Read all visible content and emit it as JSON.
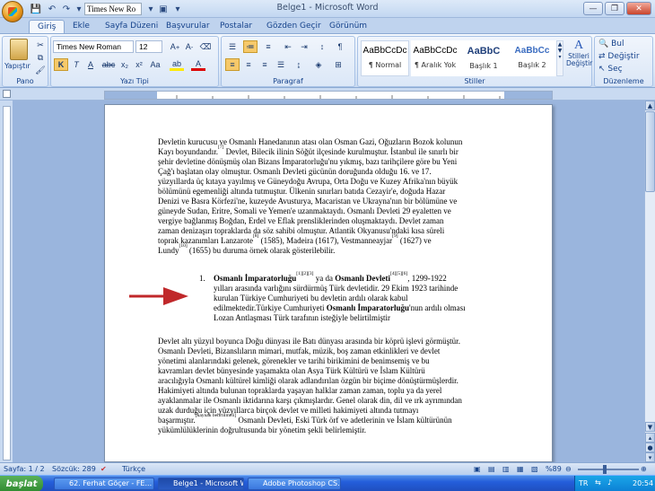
{
  "window": {
    "title": "Belge1 - Microsoft Word"
  },
  "qat": {
    "font_name": "Times New Ro"
  },
  "tabs": [
    "Giriş",
    "Ekle",
    "Sayfa Düzeni",
    "Başvurular",
    "Postalar",
    "Gözden Geçir",
    "Görünüm"
  ],
  "ribbon": {
    "paste_label": "Yapıştır",
    "font_name": "Times New Roman",
    "font_size": "12",
    "groups": {
      "clipboard": "Pano",
      "font": "Yazı Tipi",
      "paragraph": "Paragraf",
      "styles": "Stiller",
      "editing": "Düzenleme"
    },
    "styles": [
      {
        "preview": "AaBbCcDc",
        "name": "¶ Normal"
      },
      {
        "preview": "AaBbCcDc",
        "name": "¶ Aralık Yok"
      },
      {
        "preview": "AaBbC",
        "name": "Başlık 1"
      },
      {
        "preview": "AaBbCc",
        "name": "Başlık 2"
      }
    ],
    "change_styles": "Stilleri Değiştir",
    "find": "Bul",
    "replace": "Değiştir",
    "select": "Seç"
  },
  "document": {
    "para1": [
      "Devletin kurucusu ve Osmanlı Hanedanının atası olan Osman Gazi, Oğuzların Bozok kolunun",
      "Kayı boyundandır.",
      " Devlet, Bilecik ilinin Söğüt ilçesinde kurulmuştur. İstanbul ile sınırlı bir",
      "şehir devletine dönüşmüş olan Bizans İmparatorluğu'nu yıkmış, bazı tarihçilere göre bu Yeni",
      "Çağ'ı başlatan olay olmuştur. Osmanlı Devleti gücünün doruğunda olduğu 16. ve 17.",
      "yüzyıllarda üç kıtaya yayılmış ve Güneydoğu Avrupa, Orta Doğu ve Kuzey Afrika'nın büyük",
      "bölümünü egemenliği altında tutmuştur. Ülkenin sınırları batıda Cezayir'e, doğuda Hazar",
      "Denizi ve Basra Körfezi'ne, kuzeyde Avusturya, Macaristan ve Ukrayna'nın bir bölümüne ve",
      "güneyde Sudan, Eritre, Somali ve Yemen'e uzanmaktaydı. Osmanlı Devleti 29 eyaletten ve",
      "vergiye bağlanmış Boğdan, Erdel ve Eflak prensliklerinden oluşmaktaydı. Devlet zaman",
      "zaman denizaşırı topraklarda da söz sahibi olmuştur. Atlantik Okyanusu'ndaki kısa süreli",
      "toprak kazanımları Lanzarote",
      " (1585), Madeira (1617), Vestmanneayjar",
      " (1627) ve",
      "Lundy",
      " (1655) bu duruma örnek olarak gösterilebilir."
    ],
    "refs": {
      "r7": "[7]",
      "r8": "[8]",
      "r9": "[9]",
      "r10": "[10]",
      "r123": "[1][2][3]",
      "r456": "[4][5][6]",
      "note": "[kaynak belirtilmeli]"
    },
    "list": {
      "number": "1.",
      "bold1": "Osmanlı İmparatorluğu",
      "mid1": " ya da ",
      "bold2": "Osmanlı Devleti",
      "end1": ", 1299-1922",
      "line2": "yılları arasında varlığını sürdürmüş Türk devletidir. 29 Ekim 1923 tarihinde",
      "line3": "kurulan Türkiye Cumhuriyeti bu devletin ardılı olarak kabul",
      "line4a": "edilmektedir.Türkiye Cumhuriyeti ",
      "bold3": "Osmanlı İmparatorluğu",
      "line4b": "'nun ardılı olması",
      "line5": "Lozan Antlaşması Türk tarafının isteğiyle belirtilmiştir"
    },
    "para2": [
      "Devlet altı yüzyıl boyunca Doğu dünyası ile Batı dünyası arasında bir köprü işlevi görmüştür.",
      "Osmanlı Devleti, Bizanslıların mimari, mutfak, müzik, boş zaman etkinlikleri ve devlet",
      "yönetimi alanlarındaki gelenek, görenekler ve tarihi birikimini de benimsemiş ve bu",
      "kavramları devlet bünyesinde yaşamakta olan Asya Türk Kültürü ve İslam Kültürü",
      "aracılığıyla Osmanlı kültürel kimliği olarak adlandırılan özgün bir biçime dönüştürmüşlerdir.",
      "Hakimiyeti altında bulunan topraklarda yaşayan halklar zaman zaman, toplu ya da yerel",
      "ayaklanmalar ile Osmanlı iktidarına karşı çıkmışlardır. Genel olarak din, dil ve ırk ayrımından",
      "uzak durduğu için yüzyıllarca birçok devlet ve milleti hakimiyeti altında tutmayı",
      "başarmıştır.",
      " Osmanlı Devleti, Eski Türk örf ve adetlerinin ve İslam kültürünün",
      "yükümlülüklerinin doğrultusunda bir yönetim şekli belirlemiştir."
    ]
  },
  "statusbar": {
    "page": "Sayfa: 1 / 2",
    "words": "Sözcük: 289",
    "language": "Türkçe",
    "zoom": "%89"
  },
  "taskbar": {
    "start": "başlat",
    "tasks": [
      "62. Ferhat Göçer - FE...",
      "Belge1 - Microsoft Word",
      "Adobe Photoshop CS..."
    ],
    "lang": "TR",
    "clock": "20:54"
  },
  "colors": {
    "accent": "#15428b",
    "arrow": "#c0282a",
    "ribbon": "#dce8f7"
  }
}
